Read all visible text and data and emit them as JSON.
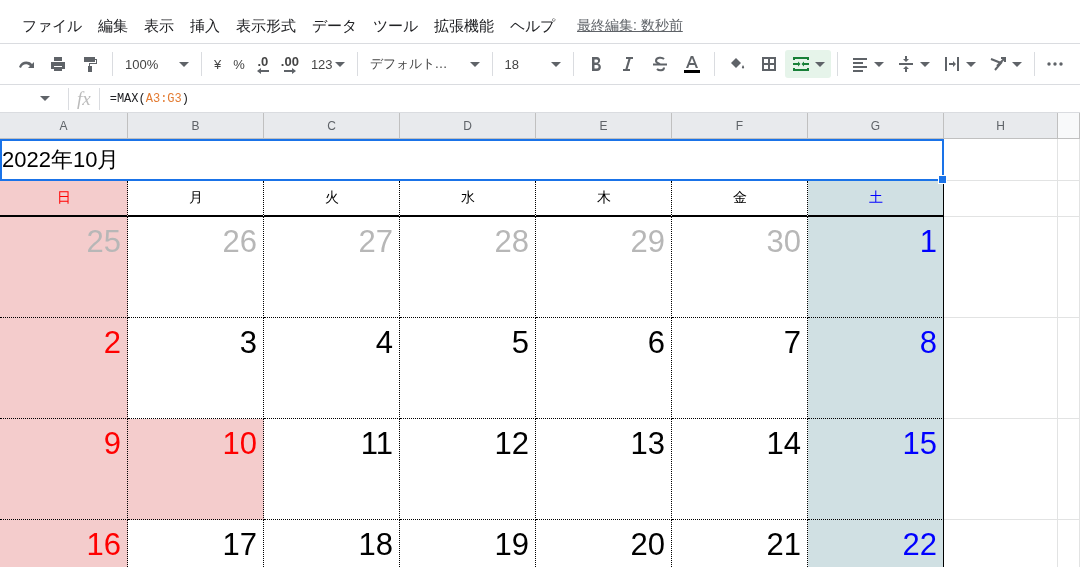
{
  "menu": {
    "items": [
      "ファイル",
      "編集",
      "表示",
      "挿入",
      "表示形式",
      "データ",
      "ツール",
      "拡張機能",
      "ヘルプ"
    ],
    "last_edit": "最終編集: 数秒前"
  },
  "toolbar": [
    {
      "kind": "redo"
    },
    {
      "kind": "print"
    },
    {
      "kind": "paint-format"
    },
    {
      "kind": "sep"
    },
    {
      "kind": "dropdown",
      "text": "100%"
    },
    {
      "kind": "sep"
    },
    {
      "kind": "text",
      "text": "¥"
    },
    {
      "kind": "text",
      "text": "%"
    },
    {
      "kind": "decimal-less",
      "text": ".0"
    },
    {
      "kind": "decimal-more",
      "text": ".00"
    },
    {
      "kind": "menu-text",
      "text": "123"
    },
    {
      "kind": "sep"
    },
    {
      "kind": "dropdown",
      "text": "デフォルト…"
    },
    {
      "kind": "sep"
    },
    {
      "kind": "dropdown",
      "text": "18"
    },
    {
      "kind": "sep"
    },
    {
      "kind": "bold",
      "selected": false
    },
    {
      "kind": "italic",
      "selected": false
    },
    {
      "kind": "strike",
      "selected": false
    },
    {
      "kind": "text-color"
    },
    {
      "kind": "sep"
    },
    {
      "kind": "fill"
    },
    {
      "kind": "borders"
    },
    {
      "kind": "merge",
      "selected": true
    },
    {
      "kind": "sep"
    },
    {
      "kind": "align"
    },
    {
      "kind": "valign"
    },
    {
      "kind": "wrap"
    },
    {
      "kind": "rotate"
    },
    {
      "kind": "sep"
    },
    {
      "kind": "more"
    }
  ],
  "formula_bar": {
    "fx": "fx",
    "formula": [
      {
        "kind": "plain",
        "text": "=MAX("
      },
      {
        "kind": "ref",
        "text": "A3:G3"
      },
      {
        "kind": "plain",
        "text": ")"
      }
    ]
  },
  "columns": [
    "A",
    "B",
    "C",
    "D",
    "E",
    "F",
    "G",
    "H"
  ],
  "title_cell": {
    "text": "2022年10月",
    "selected": true
  },
  "weekdays": [
    {
      "text": "日",
      "kind": "sun"
    },
    {
      "text": "月",
      "kind": "weekday"
    },
    {
      "text": "火",
      "kind": "weekday"
    },
    {
      "text": "水",
      "kind": "weekday"
    },
    {
      "text": "木",
      "kind": "weekday"
    },
    {
      "text": "金",
      "kind": "weekday"
    },
    {
      "text": "土",
      "kind": "sat"
    }
  ],
  "weeks": [
    [
      {
        "text": "25",
        "kind": "sun",
        "outside": true
      },
      {
        "text": "26",
        "kind": "weekday",
        "outside": true
      },
      {
        "text": "27",
        "kind": "weekday",
        "outside": true
      },
      {
        "text": "28",
        "kind": "weekday",
        "outside": true
      },
      {
        "text": "29",
        "kind": "weekday",
        "outside": true
      },
      {
        "text": "30",
        "kind": "weekday",
        "outside": true
      },
      {
        "text": "1",
        "kind": "sat",
        "outside": false
      }
    ],
    [
      {
        "text": "2",
        "kind": "sun",
        "outside": false
      },
      {
        "text": "3",
        "kind": "weekday",
        "outside": false
      },
      {
        "text": "4",
        "kind": "weekday",
        "outside": false
      },
      {
        "text": "5",
        "kind": "weekday",
        "outside": false
      },
      {
        "text": "6",
        "kind": "weekday",
        "outside": false
      },
      {
        "text": "7",
        "kind": "weekday",
        "outside": false
      },
      {
        "text": "8",
        "kind": "sat",
        "outside": false
      }
    ],
    [
      {
        "text": "9",
        "kind": "sun",
        "outside": false
      },
      {
        "text": "10",
        "kind": "holiday",
        "outside": false
      },
      {
        "text": "11",
        "kind": "weekday",
        "outside": false
      },
      {
        "text": "12",
        "kind": "weekday",
        "outside": false
      },
      {
        "text": "13",
        "kind": "weekday",
        "outside": false
      },
      {
        "text": "14",
        "kind": "weekday",
        "outside": false
      },
      {
        "text": "15",
        "kind": "sat",
        "outside": false
      }
    ],
    [
      {
        "text": "16",
        "kind": "sun",
        "outside": false
      },
      {
        "text": "17",
        "kind": "weekday",
        "outside": false
      },
      {
        "text": "18",
        "kind": "weekday",
        "outside": false
      },
      {
        "text": "19",
        "kind": "weekday",
        "outside": false
      },
      {
        "text": "20",
        "kind": "weekday",
        "outside": false
      },
      {
        "text": "21",
        "kind": "weekday",
        "outside": false
      },
      {
        "text": "22",
        "kind": "sat",
        "outside": false
      }
    ]
  ]
}
